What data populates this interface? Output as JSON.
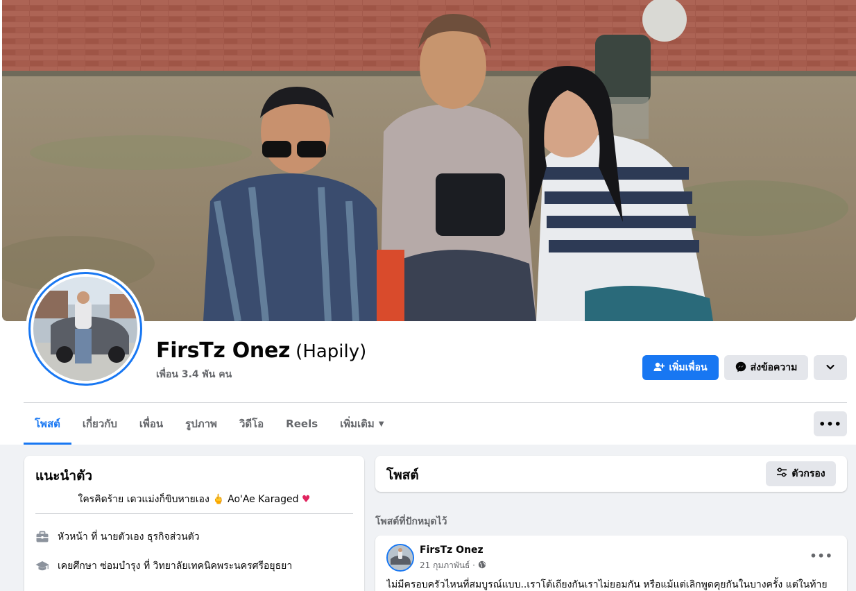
{
  "profile": {
    "name": "FirsTz Onez",
    "alternate_name": "(Hapily)",
    "friends": "เพื่อน 3.4 พัน คน"
  },
  "actions": {
    "add_friend": "เพิ่มเพื่อน",
    "message": "ส่งข้อความ"
  },
  "tabs": [
    {
      "label": "โพสต์",
      "active": true
    },
    {
      "label": "เกี่ยวกับ"
    },
    {
      "label": "เพื่อน"
    },
    {
      "label": "รูปภาพ"
    },
    {
      "label": "วิดีโอ"
    },
    {
      "label": "Reels"
    },
    {
      "label": "เพิ่มเติม"
    }
  ],
  "intro": {
    "title": "แนะนำตัว",
    "bio": "ใครคิดร้าย เดวแม่งก็ขิบหายเอง 🖕 Ao'Ae Karaged",
    "items": [
      {
        "icon": "briefcase-icon",
        "text": "หัวหน้า ที่ นายตัวเอง ธุรกิจส่วนตัว"
      },
      {
        "icon": "graduation-cap-icon",
        "text": "เคยศึกษา ซ่อมบำรุง ที่ วิทยาลัยเทคนิคพระนครศรีอยุธยา"
      }
    ]
  },
  "posts": {
    "title": "โพสต์",
    "filter_label": "ตัวกรอง",
    "pinned_label": "โพสต์ที่ปักหมุดไว้",
    "pinned_post": {
      "author": "FirsTz Onez",
      "date": "21 กุมภาพันธ์ ·",
      "text": "ไม่มีครอบครัวไหนที่สมบูรณ์แบบ..เราโต้เถียงกันเราไม่ยอมกัน หรือแม้แต่เลิกพูดคุยกันในบางครั้ง แต่ในท้าย"
    }
  },
  "colors": {
    "accent": "#1877f2",
    "secondary_button": "#e4e6eb",
    "page_background": "#f0f2f5"
  }
}
